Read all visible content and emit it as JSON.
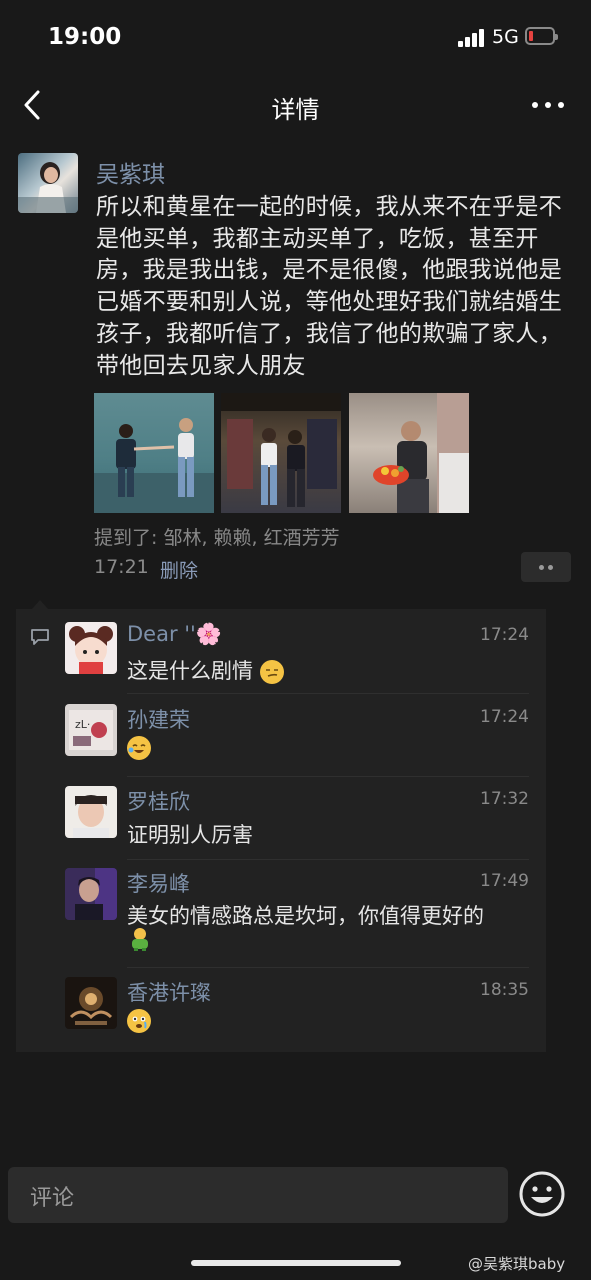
{
  "status_bar": {
    "time": "19:00",
    "network": "5G",
    "battery_color": "#e64340"
  },
  "nav": {
    "title": "详情",
    "back_icon": "chevron-left-icon",
    "more_icon": "more-dots-icon"
  },
  "post": {
    "author": "吴紫琪",
    "text": "所以和黄星在一起的时候，我从来不在乎是不是他买单，我都主动买单了，吃饭，甚至开房，我是我出钱，是不是很傻，他跟我说他是已婚不要和别人说，等他处理好我们就结婚生孩子，我都听信了，我信了他的欺骗了家人，带他回去见家人朋友",
    "mention": "提到了: 邹林, 赖赖, 红酒芳芳",
    "time": "17:21",
    "delete_label": "删除"
  },
  "comments": [
    {
      "name": "Dear ''🌸",
      "time": "17:24",
      "text": "这是什么剧情",
      "emoji": "smirk-emoji"
    },
    {
      "name": "孙建荣",
      "time": "17:24",
      "text": "",
      "emoji": "crying-laughing-emoji"
    },
    {
      "name": "罗桂欣",
      "time": "17:32",
      "text": "证明别人厉害",
      "emoji": ""
    },
    {
      "name": "李易峰",
      "time": "17:49",
      "text": "美女的情感路总是坎坷，你值得更好的",
      "emoji": "green-figure-emoji"
    },
    {
      "name": "香港许璨",
      "time": "18:35",
      "text": "",
      "emoji": "tearful-emoji"
    }
  ],
  "input": {
    "placeholder": "评论"
  },
  "watermark": "@吴紫琪baby",
  "colors": {
    "background": "#191919",
    "name_link": "#7d90a9",
    "comment_panel": "#222222"
  }
}
